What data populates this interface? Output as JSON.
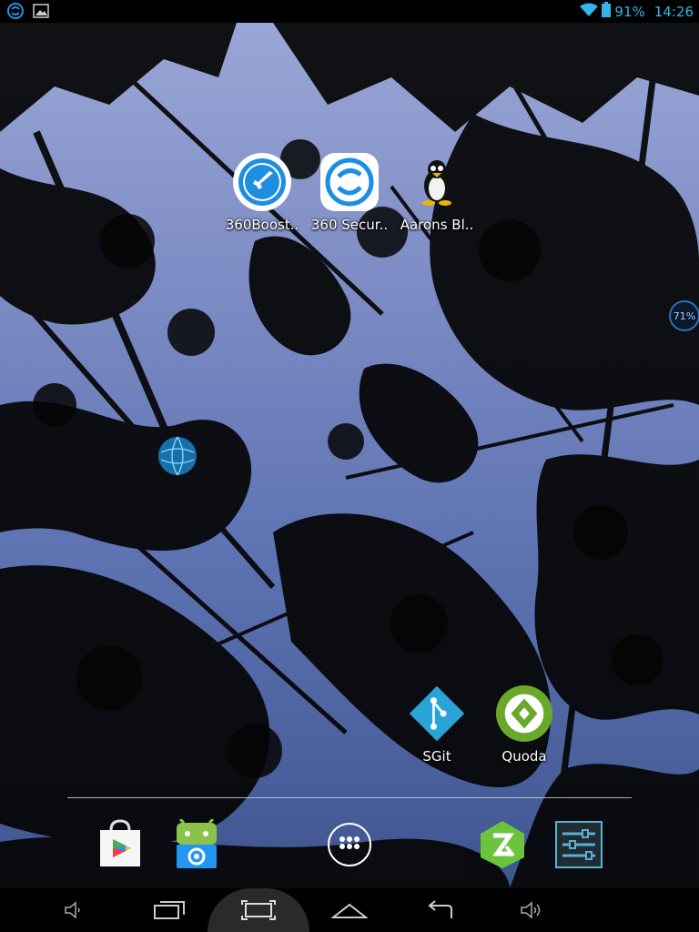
{
  "status_bar": {
    "battery_percent": "91%",
    "time": "14:26",
    "icons": [
      "360-security-icon",
      "image-icon",
      "wifi-icon",
      "battery-icon"
    ]
  },
  "desktop": {
    "apps": [
      {
        "label": "360Boost..",
        "icon": "rocket-icon"
      },
      {
        "label": "360 Secur..",
        "icon": "360-security-icon"
      },
      {
        "label": "Aarons Bl..",
        "icon": "tux-penguin-icon"
      },
      {
        "label": "SGit",
        "icon": "git-icon"
      },
      {
        "label": "Quoda",
        "icon": "quoda-icon"
      }
    ],
    "widget_text": "71%"
  },
  "dock": {
    "items": [
      {
        "name": "play-store",
        "icon": "play-store-icon"
      },
      {
        "name": "android-app",
        "icon": "android-icon"
      },
      {
        "name": "all-apps",
        "icon": "app-drawer-icon"
      },
      {
        "name": "zarchiver",
        "icon": "zarchiver-icon"
      },
      {
        "name": "settings",
        "icon": "settings-sliders-icon"
      }
    ]
  },
  "nav_bar": {
    "buttons": [
      "volume-down-icon",
      "recents-icon",
      "screenshot-icon",
      "home-icon",
      "back-icon",
      "volume-up-icon"
    ]
  },
  "colors": {
    "status_accent": "#33b5e5",
    "sgit_blue": "#29a3d8",
    "quoda_green": "#6aa829"
  }
}
